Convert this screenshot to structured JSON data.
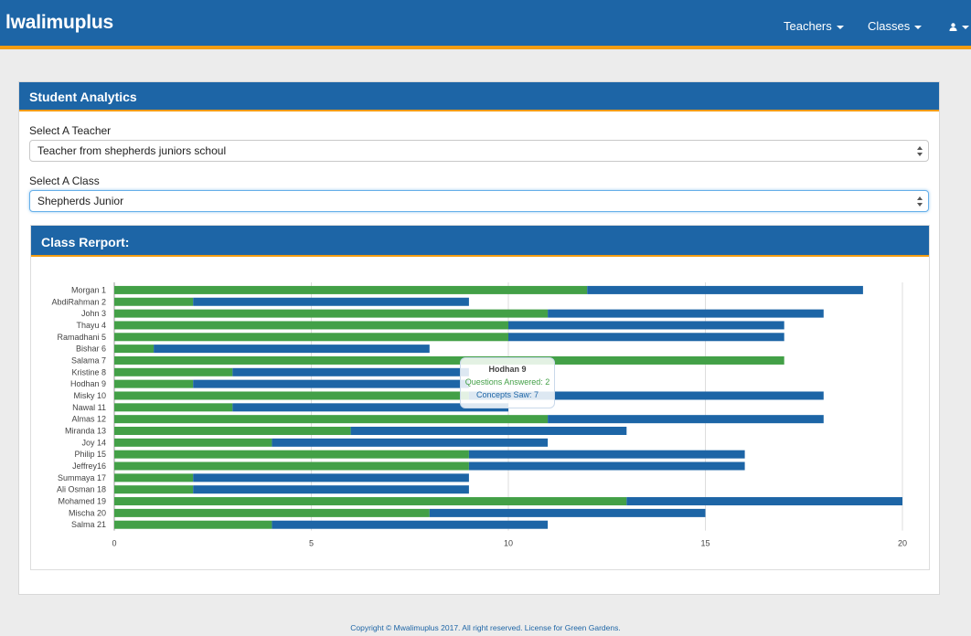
{
  "navbar": {
    "brand": "lwalimuplus",
    "teachers_label": "Teachers",
    "classes_label": "Classes",
    "user_icon": "user-icon"
  },
  "panel": {
    "title": "Student Analytics",
    "teacher_label": "Select A Teacher",
    "teacher_value": "Teacher from shepherds juniors schoul",
    "class_label": "Select A Class",
    "class_value": "Shepherds Junior"
  },
  "report": {
    "title": "Class Rerport:"
  },
  "tooltip": {
    "title": "Hodhan 9",
    "line1": "Questions Answered: 2",
    "line2": "Concepts Saw: 7"
  },
  "colors": {
    "brand_blue": "#1d65a6",
    "accent_orange": "#f39c12",
    "questions_green": "#43a047",
    "concepts_blue": "#1d65a6"
  },
  "chart_data": {
    "type": "bar",
    "orientation": "horizontal",
    "stacked": true,
    "categories": [
      "Morgan 1",
      "AbdiRahman 2",
      "John 3",
      "Thayu 4",
      "Ramadhani 5",
      "Bishar 6",
      "Salama 7",
      "Kristine 8",
      "Hodhan 9",
      "Misky 10",
      "Nawal 11",
      "Almas 12",
      "Miranda 13",
      "Joy 14",
      "Philip 15",
      "Jeffrey16",
      "Summaya 17",
      "Ali Osman 18",
      "Mohamed 19",
      "Mischa 20",
      "Salma 21"
    ],
    "series": [
      {
        "name": "Questions Answered",
        "values": [
          12,
          2,
          11,
          10,
          10,
          1,
          17,
          3,
          2,
          9,
          3,
          11,
          6,
          4,
          9,
          9,
          2,
          2,
          13,
          8,
          4
        ]
      },
      {
        "name": "Concepts Saw",
        "values": [
          7,
          7,
          7,
          7,
          7,
          7,
          0,
          6,
          7,
          9,
          7,
          7,
          7,
          7,
          7,
          7,
          7,
          7,
          7,
          7,
          7
        ]
      }
    ],
    "xlim": [
      0,
      20
    ],
    "xticks": [
      "0",
      "5",
      "10",
      "15",
      "20"
    ],
    "grid": true
  }
}
